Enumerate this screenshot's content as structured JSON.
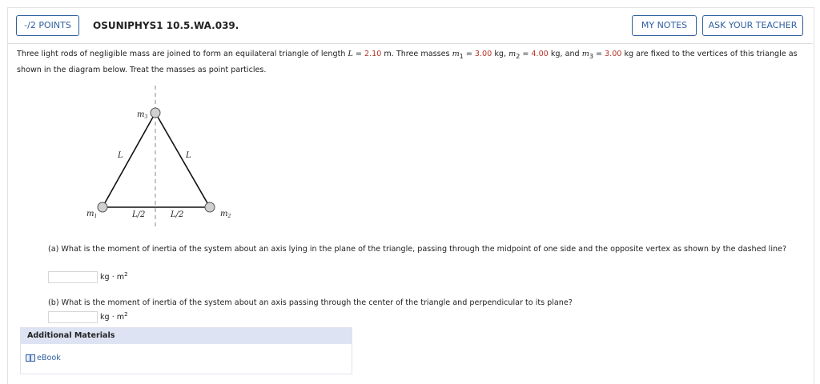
{
  "header": {
    "points_label": "-/2 POINTS",
    "question_id": "OSUNIPHYS1 10.5.WA.039.",
    "my_notes_label": "MY NOTES",
    "ask_teacher_label": "ASK YOUR TEACHER"
  },
  "problem": {
    "t1": "Three light rods of negligible mass are joined to form an equilateral triangle of length ",
    "L_sym": "L",
    "eq1": " = ",
    "L_val": "2.10",
    "t2": " m. Three masses ",
    "m1_sym": "m",
    "m1_sub": "1",
    "m1_val": "3.00",
    "t3": " kg, ",
    "m2_sym": "m",
    "m2_sub": "2",
    "m2_val": "4.00",
    "t4": " kg, and ",
    "m3_sym": "m",
    "m3_sub": "3",
    "m3_val": "3.00",
    "t5": " kg are fixed to the vertices of this triangle as shown in the diagram below. Treat the masses as point particles."
  },
  "diagram": {
    "m1": "m",
    "m1_sub": "1",
    "m2": "m",
    "m2_sub": "2",
    "m3": "m",
    "m3_sub": "3",
    "left_side": "L",
    "right_side": "L",
    "half_left": "L/2",
    "half_right": "L/2"
  },
  "part_a": {
    "question": "(a) What is the moment of inertia of the system about an axis lying in the plane of the triangle, passing through the midpoint of one side and the opposite vertex as shown by the dashed line?",
    "answer": "",
    "unit": "kg · m",
    "unit_exp": "2"
  },
  "part_b": {
    "question": "(b) What is the moment of inertia of the system about an axis passing through the center of the triangle and perpendicular to its plane?",
    "answer": "",
    "unit": "kg · m",
    "unit_exp": "2"
  },
  "additional": {
    "title": "Additional Materials",
    "ebook_label": "eBook"
  },
  "colors": {
    "accent": "#2f5fa0",
    "value_red": "#b5332a",
    "panel_header": "#dde3f2"
  }
}
